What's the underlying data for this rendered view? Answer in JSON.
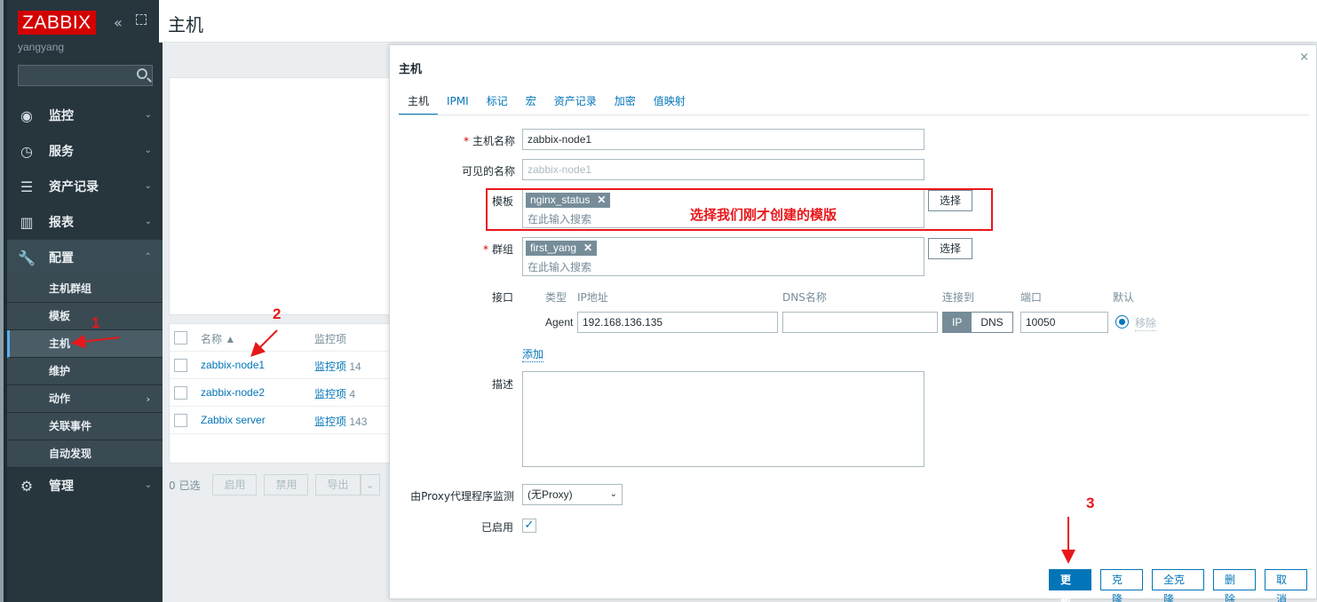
{
  "sidebar": {
    "logo": "ZABBIX",
    "collapse_icon": "«",
    "user": "yangyang",
    "menu": [
      {
        "label": "监控",
        "icon": "eye-icon",
        "glyph": "◉"
      },
      {
        "label": "服务",
        "icon": "stopwatch-icon",
        "glyph": "◷"
      },
      {
        "label": "资产记录",
        "icon": "list-icon",
        "glyph": "☰"
      },
      {
        "label": "报表",
        "icon": "bar-chart-icon",
        "glyph": "▥"
      },
      {
        "label": "配置",
        "icon": "wrench-icon",
        "glyph": "🔧"
      },
      {
        "label": "管理",
        "icon": "gear-icon",
        "glyph": "⚙"
      }
    ],
    "submenu": [
      "主机群组",
      "模板",
      "主机",
      "维护",
      "动作",
      "关联事件",
      "自动发现"
    ],
    "chev_down": "⌄",
    "chev_up": "⌃",
    "chev_right": "›"
  },
  "page": {
    "title": "主机"
  },
  "host_table": {
    "col_name": "名称 ▲",
    "col_items": "监控项",
    "rows": [
      {
        "name": "zabbix-node1",
        "items": "监控项",
        "count": "14"
      },
      {
        "name": "zabbix-node2",
        "items": "监控项",
        "count": "4"
      },
      {
        "name": "Zabbix server",
        "items": "监控项",
        "count": "143"
      }
    ]
  },
  "bottom": {
    "selected": "0 已选",
    "enable": "启用",
    "disable": "禁用",
    "export": "导出",
    "export_arrow": "⌄"
  },
  "modal": {
    "title": "主机",
    "close": "×",
    "tabs": [
      "主机",
      "IPMI",
      "标记",
      "宏",
      "资产记录",
      "加密",
      "值映射"
    ],
    "form": {
      "host_name_label": "主机名称",
      "host_name_value": "zabbix-node1",
      "visible_name_label": "可见的名称",
      "visible_name_placeholder": "zabbix-node1",
      "templates_label": "模板",
      "template_chip": "nginx_status",
      "chip_x": "✕",
      "search_placeholder": "在此输入搜索",
      "select_btn": "选择",
      "groups_label": "群组",
      "group_chip": "first_yang",
      "interfaces_label": "接口",
      "iface_headers": {
        "type": "类型",
        "ip": "IP地址",
        "dns": "DNS名称",
        "connect": "连接到",
        "port": "端口",
        "default": "默认"
      },
      "agent_label": "Agent",
      "agent_ip": "192.168.136.135",
      "agent_dns": "",
      "connect_ip": "IP",
      "connect_dns": "DNS",
      "agent_port": "10050",
      "remove_link": "移除",
      "add_link": "添加",
      "description_label": "描述",
      "proxy_label": "由Proxy代理程序监测",
      "proxy_value": "(无Proxy)",
      "proxy_arrow": "⌄",
      "enabled_label": "已启用",
      "enabled_check": "✓"
    },
    "buttons": {
      "update": "更新",
      "clone": "克隆",
      "full_clone": "全克隆",
      "delete": "删除",
      "cancel": "取消"
    }
  },
  "annotations": {
    "note": "选择我们刚才创建的模版",
    "step1": "1",
    "step2": "2",
    "step3": "3"
  }
}
